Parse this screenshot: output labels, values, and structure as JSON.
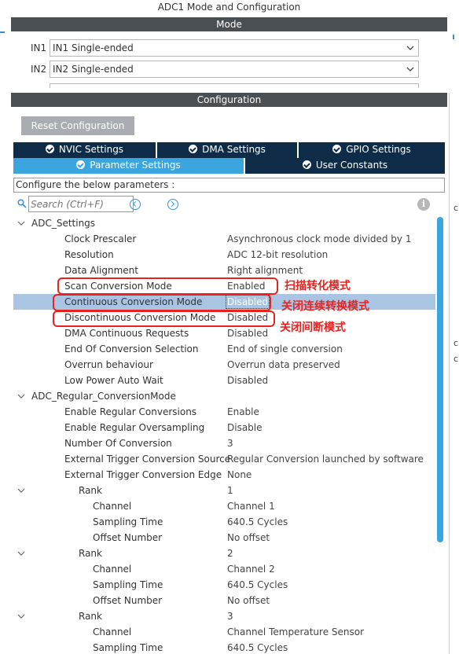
{
  "header": {
    "title": "ADC1 Mode and Configuration"
  },
  "mode": {
    "section_title": "Mode",
    "inputs": [
      {
        "label": "IN1",
        "value": "IN1 Single-ended"
      },
      {
        "label": "IN2",
        "value": "IN2 Single-ended"
      }
    ]
  },
  "configuration": {
    "section_title": "Configuration",
    "reset_label": "Reset Configuration",
    "tabs_row1": [
      "NVIC Settings",
      "DMA Settings",
      "GPIO Settings"
    ],
    "tabs_row2": [
      "Parameter Settings",
      "User Constants"
    ],
    "active_tab": "Parameter Settings",
    "hint": "Configure the below parameters :",
    "search_placeholder": "Search (Ctrl+F)"
  },
  "tree": [
    {
      "level": 0,
      "group": true,
      "name": "ADC_Settings"
    },
    {
      "level": 1,
      "name": "Clock Prescaler",
      "value": "Asynchronous clock mode divided by 1"
    },
    {
      "level": 1,
      "name": "Resolution",
      "value": "ADC 12-bit resolution"
    },
    {
      "level": 1,
      "name": "Data Alignment",
      "value": "Right alignment"
    },
    {
      "level": 1,
      "name": "Scan Conversion Mode",
      "value": "Enabled"
    },
    {
      "level": 1,
      "name": "Continuous Conversion Mode",
      "value": "Disabled",
      "selected": true
    },
    {
      "level": 1,
      "name": "Discontinuous Conversion Mode",
      "value": "Disabled"
    },
    {
      "level": 1,
      "name": "DMA Continuous Requests",
      "value": "Disabled"
    },
    {
      "level": 1,
      "name": "End Of Conversion Selection",
      "value": "End of single conversion"
    },
    {
      "level": 1,
      "name": "Overrun behaviour",
      "value": "Overrun data preserved"
    },
    {
      "level": 1,
      "name": "Low Power Auto Wait",
      "value": "Disabled"
    },
    {
      "level": 0,
      "group": true,
      "name": "ADC_Regular_ConversionMode"
    },
    {
      "level": 1,
      "name": "Enable Regular Conversions",
      "value": "Enable"
    },
    {
      "level": 1,
      "name": "Enable Regular Oversampling",
      "value": "Disable"
    },
    {
      "level": 1,
      "name": "Number Of Conversion",
      "value": "3"
    },
    {
      "level": 1,
      "name": "External Trigger Conversion Source",
      "value": "Regular Conversion launched by software"
    },
    {
      "level": 1,
      "name": "External Trigger Conversion Edge",
      "value": "None"
    },
    {
      "level": 2,
      "group": true,
      "name": "Rank",
      "value": "1"
    },
    {
      "level": 3,
      "name": "Channel",
      "value": "Channel 1"
    },
    {
      "level": 3,
      "name": "Sampling Time",
      "value": "640.5 Cycles"
    },
    {
      "level": 3,
      "name": "Offset Number",
      "value": "No offset"
    },
    {
      "level": 2,
      "group": true,
      "name": "Rank",
      "value": "2"
    },
    {
      "level": 3,
      "name": "Channel",
      "value": "Channel 2"
    },
    {
      "level": 3,
      "name": "Sampling Time",
      "value": "640.5 Cycles"
    },
    {
      "level": 3,
      "name": "Offset Number",
      "value": "No offset"
    },
    {
      "level": 2,
      "group": true,
      "name": "Rank",
      "value": "3"
    },
    {
      "level": 3,
      "name": "Channel",
      "value": "Channel Temperature Sensor"
    },
    {
      "level": 3,
      "name": "Sampling Time",
      "value": "640.5 Cycles"
    }
  ],
  "annotations": {
    "scan": "扫描转化模式",
    "continuous": "关闭连续转换模式",
    "discontinuous": "关闭间断模式"
  },
  "edge_fragments": [
    "c",
    "c",
    "c"
  ],
  "colors": {
    "accent": "#3aa5de",
    "tab_dark": "#0e2b47",
    "section_bar": "#4a4f54",
    "annotation": "#e8231f",
    "selection": "#aac4e4"
  }
}
